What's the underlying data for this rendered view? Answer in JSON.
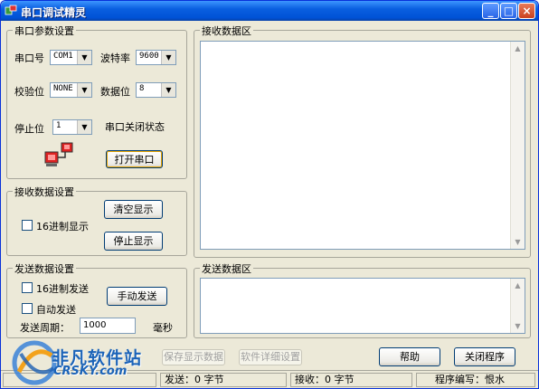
{
  "window": {
    "title": "串口调试精灵"
  },
  "port_settings": {
    "legend": "串口参数设置",
    "port_label": "串口号",
    "port_value": "COM1",
    "baud_label": "波特率",
    "baud_value": "9600",
    "parity_label": "校验位",
    "parity_value": "NONE",
    "databits_label": "数据位",
    "databits_value": "8",
    "stopbits_label": "停止位",
    "stopbits_value": "1",
    "status_text": "串口关闭状态",
    "open_button": "打开串口"
  },
  "receive_settings": {
    "legend": "接收数据设置",
    "hex_display_label": "16进制显示",
    "clear_button": "清空显示",
    "stop_button": "停止显示"
  },
  "send_settings": {
    "legend": "发送数据设置",
    "hex_send_label": "16进制发送",
    "auto_send_label": "自动发送",
    "manual_send_button": "手动发送",
    "period_label": "发送周期：",
    "period_value": "1000",
    "period_unit": "毫秒"
  },
  "receive_area": {
    "legend": "接收数据区"
  },
  "send_area": {
    "legend": "发送数据区"
  },
  "bottom_buttons": {
    "save_display": "保存显示数据",
    "software_settings": "软件详细设置",
    "help": "帮助",
    "close_program": "关闭程序"
  },
  "statusbar": {
    "send": "发送：0 字节",
    "receive": "接收：0 字节",
    "author": "程序编写：恨水"
  },
  "watermark": {
    "text": "非凡软件站",
    "sub": "CRSKY.com"
  },
  "colors": {
    "titlebar": "#0a5fe0",
    "face": "#ece9d8",
    "watermark": "#1b63b8"
  }
}
